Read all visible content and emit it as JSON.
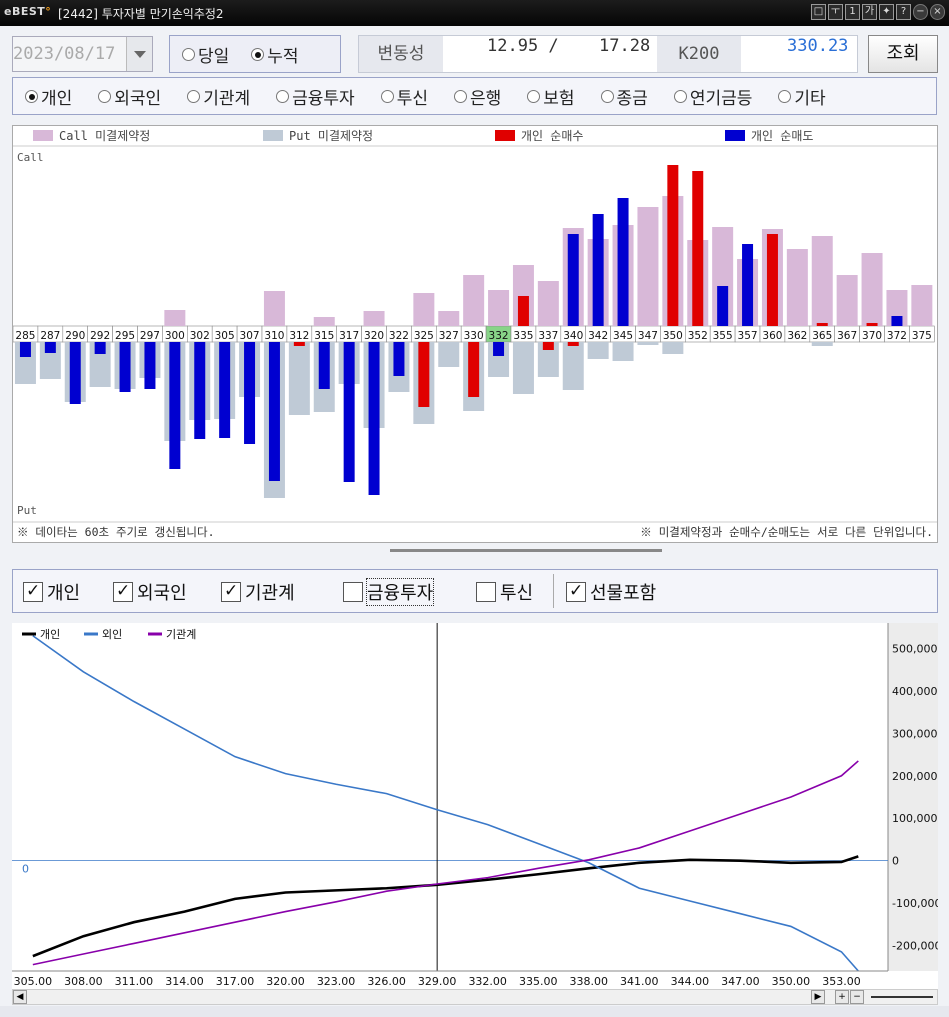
{
  "window": {
    "title": "[2442] 투자자별 만기손익추정2",
    "logo": "BEST",
    "tbtns": [
      "□",
      "ㅜ",
      "1",
      "가",
      "✦",
      "?"
    ]
  },
  "controls": {
    "date": "2023/08/17",
    "mode": [
      {
        "label": "당일",
        "on": false
      },
      {
        "label": "누적",
        "on": true
      }
    ],
    "vol_label": "변동성",
    "vol1": "12.95 /",
    "vol2": "17.28",
    "k200_label": "K200",
    "k200": "330.23",
    "query": "조회"
  },
  "investors": [
    {
      "label": "개인",
      "on": true
    },
    {
      "label": "외국인",
      "on": false
    },
    {
      "label": "기관계",
      "on": false
    },
    {
      "label": "금융투자",
      "on": false
    },
    {
      "label": "투신",
      "on": false
    },
    {
      "label": "은행",
      "on": false
    },
    {
      "label": "보험",
      "on": false
    },
    {
      "label": "종금",
      "on": false
    },
    {
      "label": "연기금등",
      "on": false
    },
    {
      "label": "기타",
      "on": false
    }
  ],
  "top": {
    "legend": [
      "Call 미결제약정",
      "Put 미결제약정",
      "개인 순매수",
      "개인 순매도"
    ],
    "colors": [
      "#d8b8d8",
      "#bfcad6",
      "#e00000",
      "#0000d0"
    ],
    "call_label": "Call",
    "put_label": "Put",
    "note_left": "※ 데이타는 60초 주기로 갱신됩니다.",
    "note_right": "※ 미결제약정과 순매수/순매도는 서로 다른 단위입니다.",
    "highlight": "332"
  },
  "chart_data": [
    {
      "type": "bar",
      "categories": [
        "285",
        "287",
        "290",
        "292",
        "295",
        "297",
        "300",
        "302",
        "305",
        "307",
        "310",
        "312",
        "315",
        "317",
        "320",
        "322",
        "325",
        "327",
        "330",
        "332",
        "335",
        "337",
        "340",
        "342",
        "345",
        "347",
        "350",
        "352",
        "355",
        "357",
        "360",
        "362",
        "365",
        "367",
        "370",
        "372",
        "375"
      ],
      "series": [
        {
          "name": "Call 미결제약정",
          "values": [
            0,
            0,
            0,
            0,
            0,
            0,
            16,
            0,
            0,
            0,
            35,
            0,
            9,
            0,
            15,
            0,
            33,
            15,
            51,
            36,
            61,
            45,
            98,
            87,
            101,
            119,
            130,
            86,
            99,
            67,
            97,
            77,
            90,
            51,
            73,
            36,
            41
          ]
        },
        {
          "name": "Put 미결제약정",
          "values": [
            -42,
            -37,
            -60,
            -45,
            -47,
            -36,
            -99,
            -78,
            -77,
            -55,
            -156,
            -73,
            -70,
            -42,
            -86,
            -50,
            -82,
            -25,
            -69,
            -35,
            -52,
            -35,
            -48,
            -17,
            -19,
            -3,
            -12,
            0,
            0,
            0,
            0,
            0,
            -4,
            0,
            0,
            0,
            0
          ]
        },
        {
          "name": "개인 순매수",
          "values": [
            0,
            0,
            0,
            0,
            0,
            0,
            0,
            0,
            0,
            0,
            0,
            -4,
            0,
            0,
            0,
            0,
            -65,
            0,
            -55,
            0,
            30,
            -8,
            -4,
            0,
            0,
            0,
            161,
            155,
            0,
            0,
            92,
            0,
            3,
            0,
            3,
            0,
            0
          ]
        },
        {
          "name": "개인 순매도",
          "values": [
            -15,
            -11,
            -62,
            -12,
            -50,
            -47,
            -127,
            -97,
            -96,
            -102,
            -139,
            0,
            -47,
            -140,
            -153,
            -34,
            0,
            0,
            0,
            -14,
            0,
            0,
            92,
            112,
            128,
            0,
            0,
            0,
            40,
            82,
            0,
            0,
            0,
            0,
            0,
            10,
            0
          ]
        }
      ]
    },
    {
      "type": "line",
      "x": [
        305,
        308,
        311,
        314,
        317,
        320,
        323,
        326,
        329,
        332,
        335,
        338,
        341,
        344,
        347,
        350,
        353,
        354
      ],
      "xlabels": [
        "305.00",
        "308.00",
        "311.00",
        "314.00",
        "317.00",
        "320.00",
        "323.00",
        "326.00",
        "329.00",
        "332.00",
        "335.00",
        "338.00",
        "341.00",
        "344.00",
        "347.00",
        "350.00",
        "353.00"
      ],
      "ylim": [
        -260000,
        560000
      ],
      "yticks": [
        500000,
        400000,
        300000,
        200000,
        100000,
        0,
        -100000,
        -200000
      ],
      "ylabels": [
        "500,000",
        "400,000",
        "300,000",
        "200,000",
        "100,000",
        "0",
        "-100,000",
        "-200,000"
      ],
      "zero_label": "0",
      "cursor_x": 329.0,
      "series": [
        {
          "name": "개인",
          "color": "#000000",
          "values": [
            -225000,
            -178000,
            -145000,
            -120000,
            -90000,
            -75000,
            -70000,
            -65000,
            -57000,
            -45000,
            -32000,
            -18000,
            -5000,
            2000,
            0,
            -5000,
            -3000,
            10000
          ]
        },
        {
          "name": "외인",
          "color": "#3a78c8",
          "values": [
            530000,
            445000,
            375000,
            310000,
            245000,
            205000,
            180000,
            158000,
            120000,
            85000,
            40000,
            -5000,
            -65000,
            -95000,
            -125000,
            -155000,
            -215000,
            -260000
          ]
        },
        {
          "name": "기관계",
          "color": "#8800aa",
          "values": [
            -245000,
            -220000,
            -195000,
            -170000,
            -145000,
            -120000,
            -97000,
            -72000,
            -55000,
            -40000,
            -18000,
            2000,
            30000,
            70000,
            110000,
            150000,
            200000,
            235000
          ]
        }
      ]
    }
  ],
  "bottom_checks": [
    {
      "label": "개인",
      "on": true
    },
    {
      "label": "외국인",
      "on": true
    },
    {
      "label": "기관계",
      "on": true
    },
    {
      "label": "금융투자",
      "on": false
    },
    {
      "label": "투신",
      "on": false
    },
    {
      "label": "선물포함",
      "on": true
    }
  ]
}
